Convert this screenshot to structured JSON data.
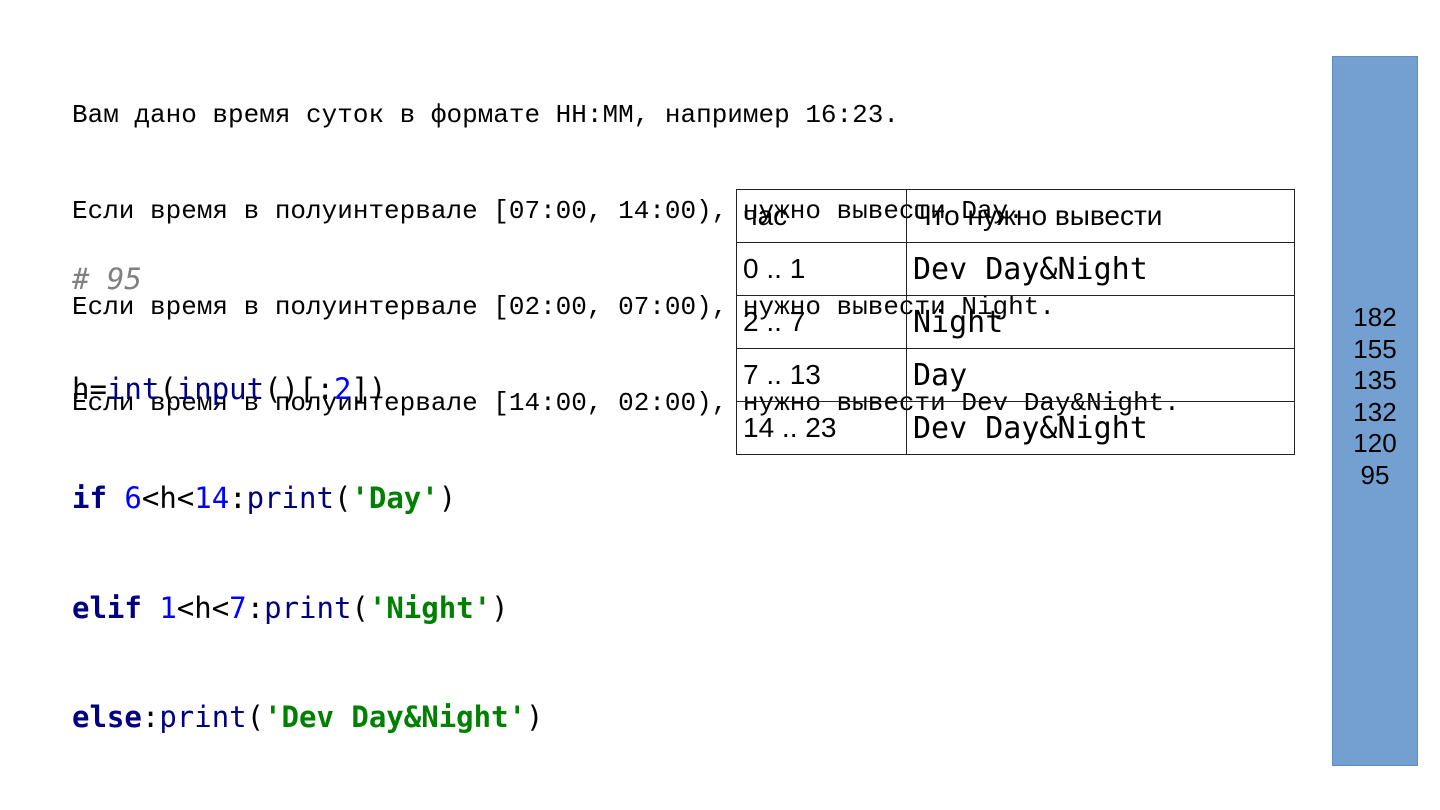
{
  "problem": {
    "lines": [
      "Вам дано время суток в формате HH:MM, например 16:23.",
      "Если время в полуинтервале [07:00, 14:00), нужно вывести Day.",
      "Если время в полуинтервале [02:00, 07:00), нужно вывести Night.",
      "Если время в полуинтервале [14:00, 02:00), нужно вывести Dev Day&Night."
    ]
  },
  "code": {
    "comment": "# 95",
    "line1": {
      "var": "h=",
      "fn1": "int",
      "p1": "(",
      "fn2": "input",
      "p2": "()[:",
      "num": "2",
      "p3": "])"
    },
    "line2": {
      "kw": "if",
      "sp": " ",
      "n1": "6",
      "op1": "<h<",
      "n2": "14",
      "colon": ":",
      "fn": "print",
      "po": "(",
      "str": "'Day'",
      "pc": ")"
    },
    "line3": {
      "kw": "elif",
      "sp": " ",
      "n1": "1",
      "op1": "<h<",
      "n2": "7",
      "colon": ":",
      "fn": "print",
      "po": "(",
      "str": "'Night'",
      "pc": ")"
    },
    "line4": {
      "kw": "else",
      "colon": ":",
      "fn": "print",
      "po": "(",
      "str": "'Dev Day&Night'",
      "pc": ")"
    }
  },
  "table": {
    "headers": [
      "час",
      "Что нужно вывести"
    ],
    "rows": [
      [
        "0 .. 1",
        "Dev Day&Night"
      ],
      [
        "2 .. 7",
        "Night"
      ],
      [
        "7 .. 13",
        "Day"
      ],
      [
        "14 .. 23",
        "Dev Day&Night"
      ]
    ]
  },
  "sidebar": {
    "numbers": [
      "182",
      "155",
      "135",
      "132",
      "120",
      "95"
    ]
  },
  "colors": {
    "sidebar": "#739fd1",
    "keyword": "#000080",
    "number": "#0000ff",
    "string": "#008000",
    "comment": "#808080"
  }
}
